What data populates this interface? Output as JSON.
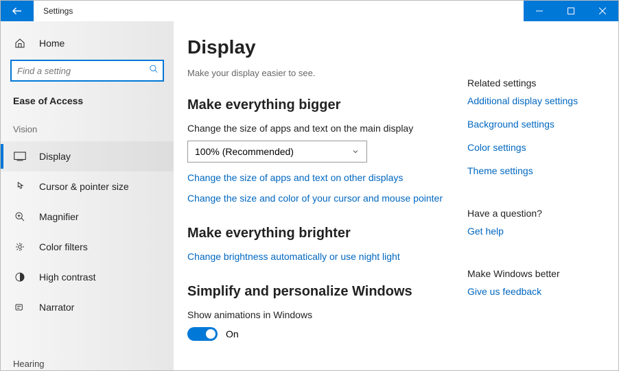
{
  "window": {
    "title": "Settings"
  },
  "sidebar": {
    "home": "Home",
    "search_placeholder": "Find a setting",
    "category": "Ease of Access",
    "group": "Vision",
    "items": [
      {
        "label": "Display"
      },
      {
        "label": "Cursor & pointer size"
      },
      {
        "label": "Magnifier"
      },
      {
        "label": "Color filters"
      },
      {
        "label": "High contrast"
      },
      {
        "label": "Narrator"
      }
    ],
    "cut_item": "Hearing"
  },
  "main": {
    "title": "Display",
    "subtitle": "Make your display easier to see.",
    "bigger": {
      "heading": "Make everything bigger",
      "desc": "Change the size of apps and text on the main display",
      "select_value": "100% (Recommended)",
      "link_other": "Change the size of apps and text on other displays",
      "link_cursor": "Change the size and color of your cursor and mouse pointer"
    },
    "brighter": {
      "heading": "Make everything brighter",
      "link_night": "Change brightness automatically or use night light"
    },
    "simplify": {
      "heading": "Simplify and personalize Windows",
      "anim_label": "Show animations in Windows",
      "anim_state": "On"
    }
  },
  "right": {
    "related_heading": "Related settings",
    "related": [
      "Additional display settings",
      "Background settings",
      "Color settings",
      "Theme settings"
    ],
    "question_heading": "Have a question?",
    "help_link": "Get help",
    "better_heading": "Make Windows better",
    "feedback_link": "Give us feedback"
  }
}
